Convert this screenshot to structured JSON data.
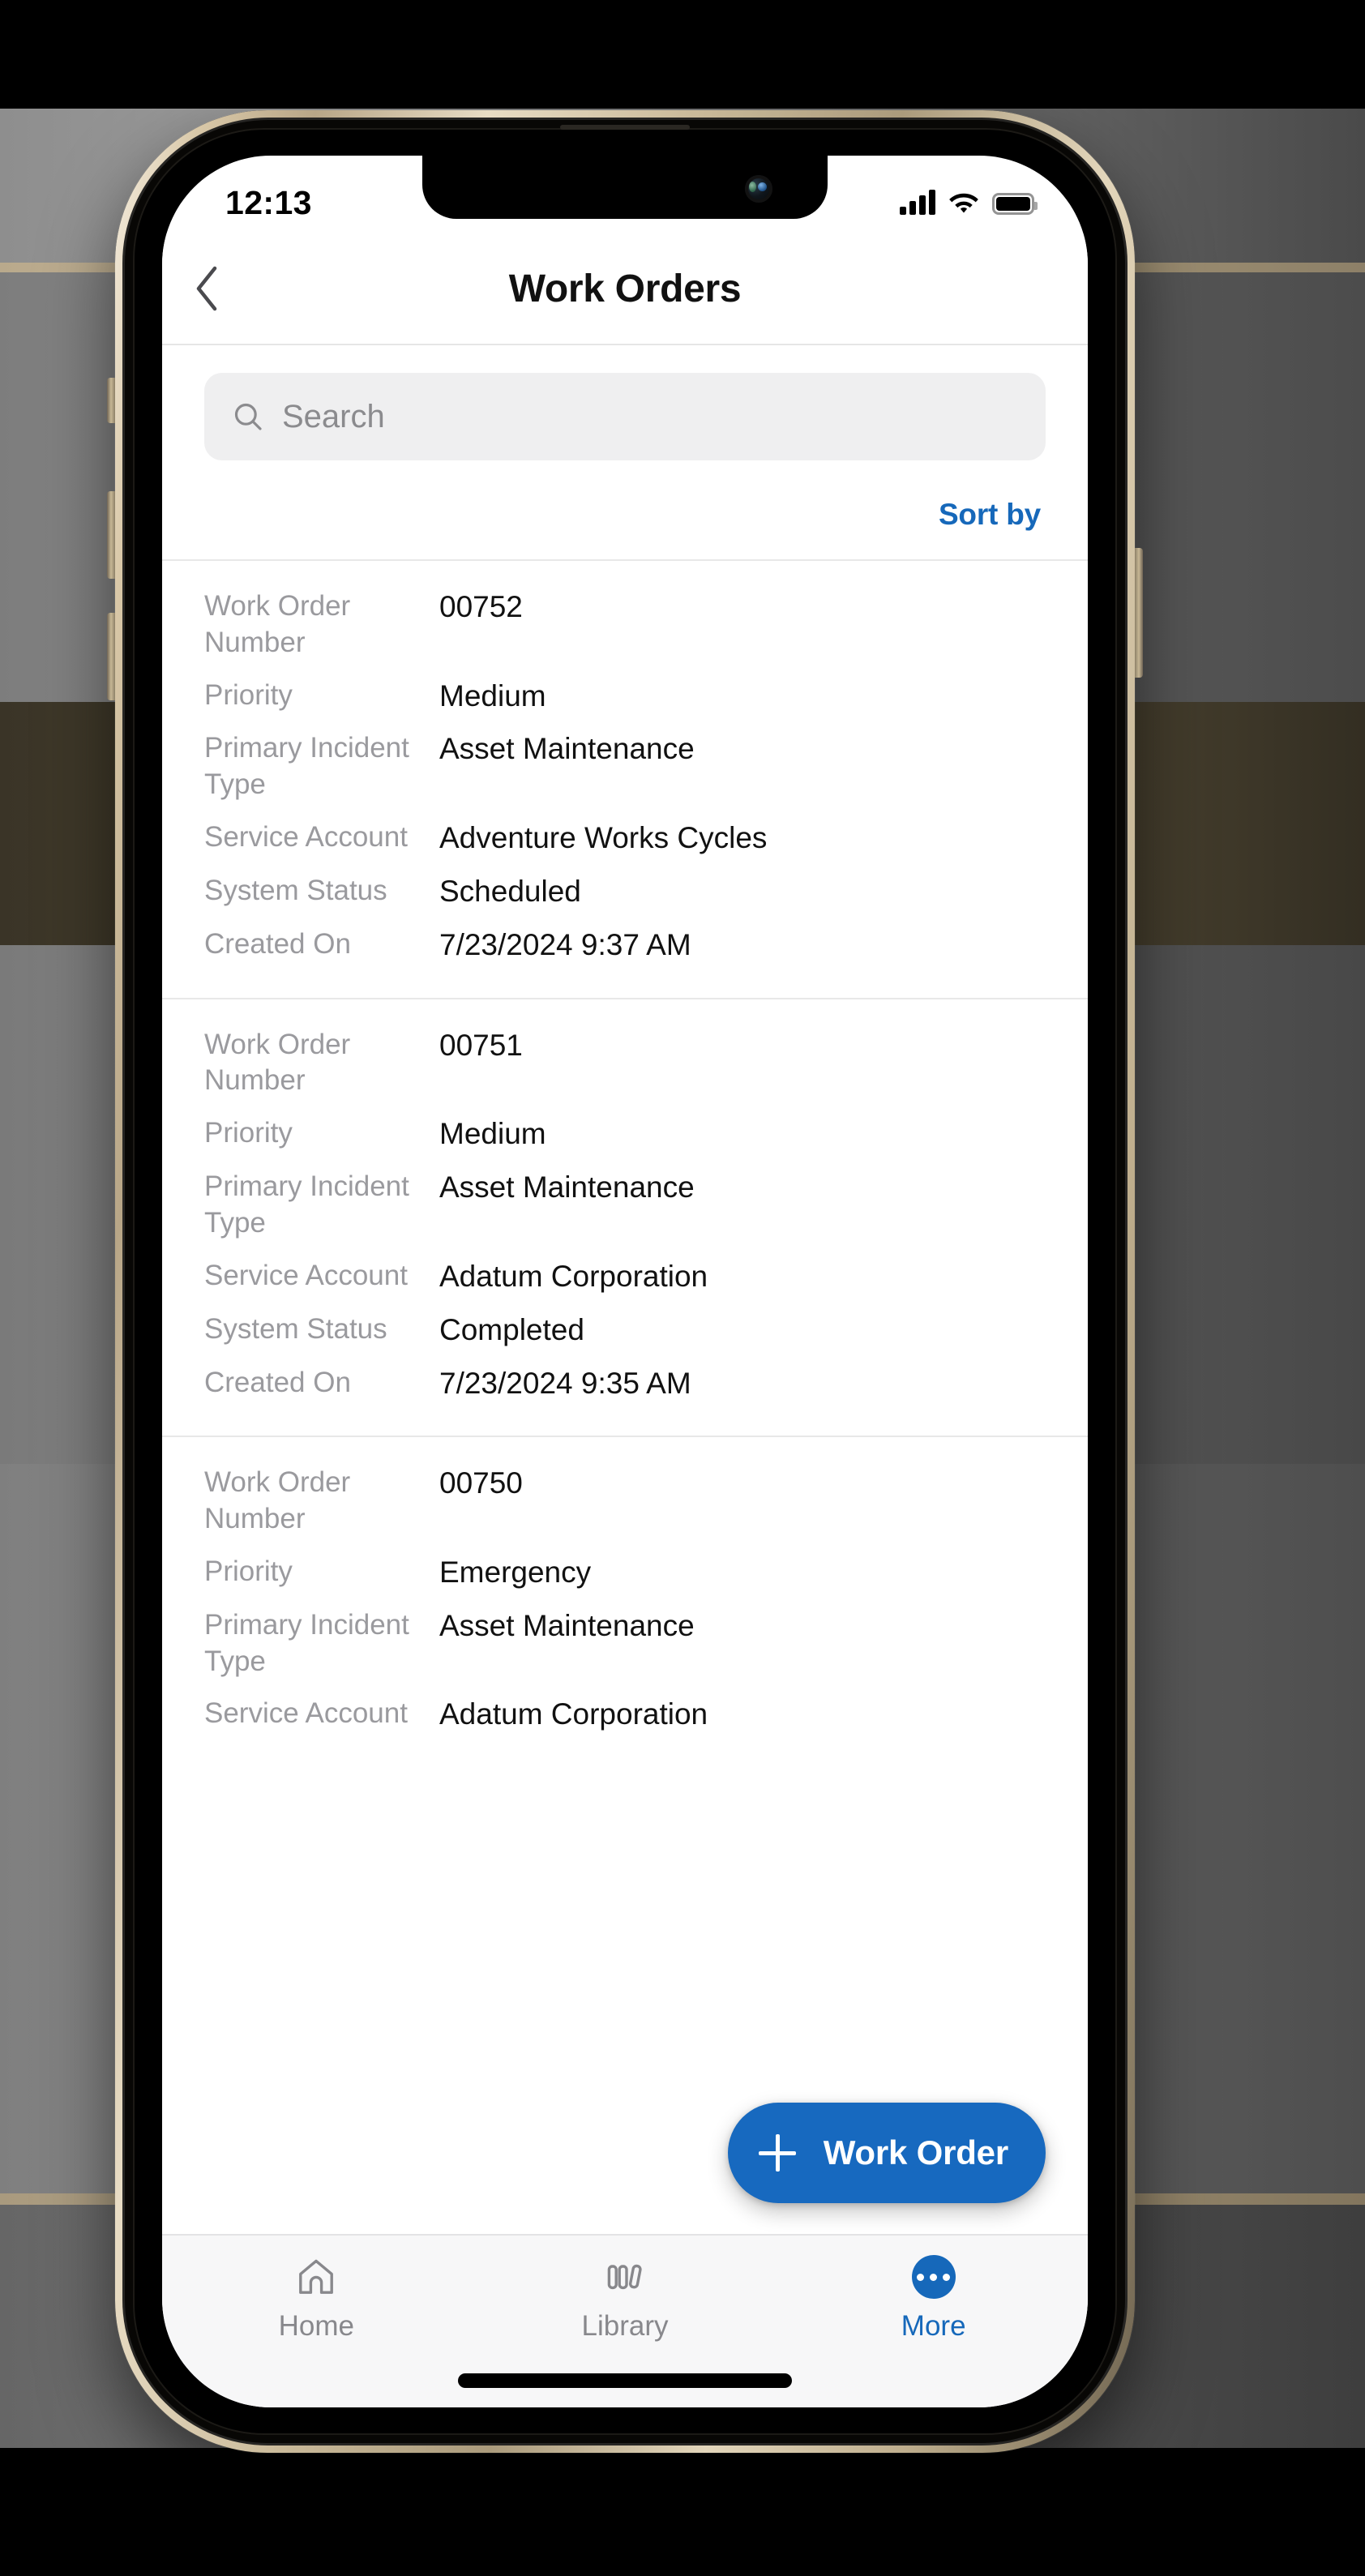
{
  "status_bar": {
    "time": "12:13",
    "signal_icon": "cellular-bars-icon",
    "signal_bars": 4,
    "wifi_icon": "wifi-icon",
    "battery_icon": "battery-full-icon"
  },
  "navbar": {
    "back_icon": "chevron-left-icon",
    "title": "Work Orders"
  },
  "search": {
    "icon": "search-icon",
    "value": "",
    "placeholder": "Search"
  },
  "toolbar": {
    "sort_by_label": "Sort by"
  },
  "field_labels": {
    "work_order_number": "Work Order Number",
    "priority": "Priority",
    "primary_incident_type": "Primary Incident Type",
    "service_account": "Service Account",
    "system_status": "System Status",
    "created_on": "Created On"
  },
  "records": [
    {
      "work_order_number": "00752",
      "priority": "Medium",
      "primary_incident_type": "Asset Maintenance",
      "service_account": "Adventure Works Cycles",
      "system_status": "Scheduled",
      "created_on": "7/23/2024 9:37 AM"
    },
    {
      "work_order_number": "00751",
      "priority": "Medium",
      "primary_incident_type": "Asset Maintenance",
      "service_account": "Adatum Corporation",
      "system_status": "Completed",
      "created_on": "7/23/2024 9:35 AM"
    },
    {
      "work_order_number": "00750",
      "priority": "Emergency",
      "primary_incident_type": "Asset Maintenance",
      "service_account": "Adatum Corporation",
      "system_status": "",
      "created_on": ""
    }
  ],
  "fab": {
    "icon": "plus-icon",
    "label": "Work Order"
  },
  "tabbar": {
    "items": [
      {
        "label": "Home",
        "icon": "home-icon",
        "active": false
      },
      {
        "label": "Library",
        "icon": "library-icon",
        "active": false
      },
      {
        "label": "More",
        "icon": "more-dots-icon",
        "active": true
      }
    ]
  },
  "colors": {
    "accent_blue": "#1668ba",
    "fab_blue": "#1769bf",
    "label_gray": "#9a9a9e",
    "value_black": "#111111",
    "search_bg": "#efeff0",
    "tabbar_bg": "#f7f7f8"
  }
}
